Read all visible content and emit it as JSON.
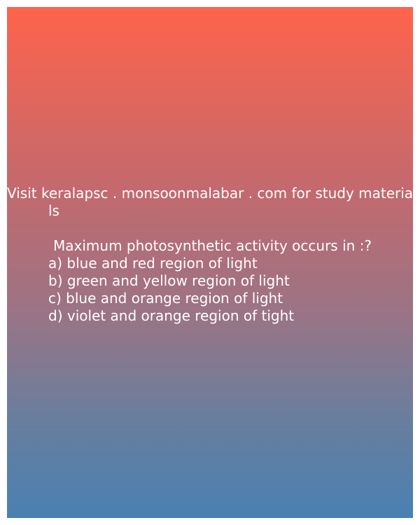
{
  "header": {
    "line1": "Visit keralapsc . monsoonmalabar . com for study materia",
    "line2": "ls"
  },
  "question": {
    "text": "Maximum photosynthetic activity occurs in :?",
    "options": [
      "a) blue and red region of light",
      "b) green and yellow region of light",
      "c) blue and orange region of light",
      "d) violet and orange region of tight"
    ]
  },
  "colors": {
    "gradient_top": "#ff634c",
    "gradient_bottom": "#4a80b2",
    "text": "#ffffff"
  }
}
